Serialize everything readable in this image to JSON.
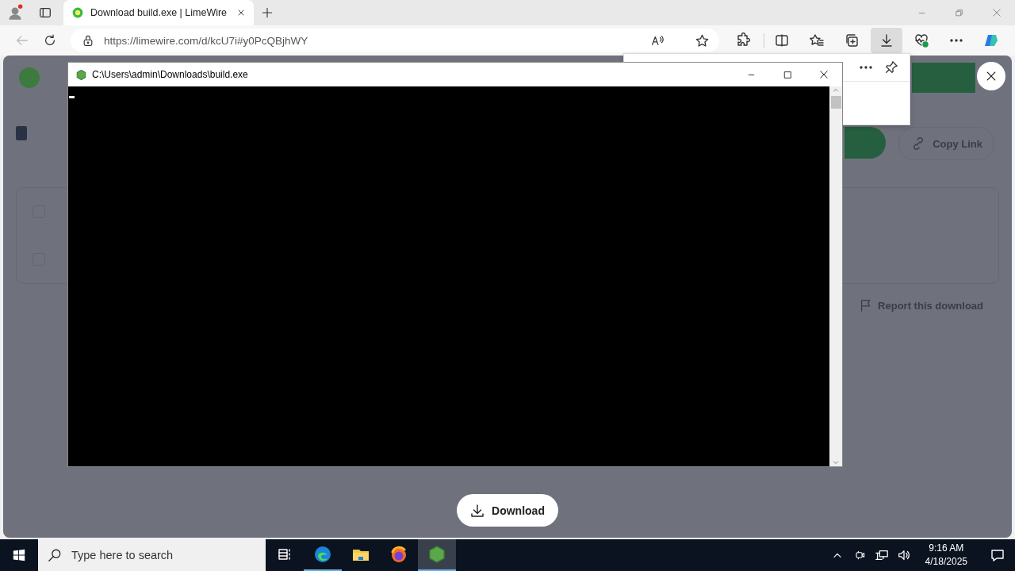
{
  "browser": {
    "tab": {
      "title": "Download build.exe | LimeWire",
      "selected": true
    },
    "url": "https://limewire.com/d/kcU7i#y0PcQBjhWY",
    "toolbar": [
      {
        "kind": "extensions",
        "selected": false
      },
      {
        "kind": "split",
        "selected": false
      },
      {
        "kind": "favorites",
        "selected": false
      },
      {
        "kind": "collections",
        "selected": false
      },
      {
        "kind": "downloads",
        "selected": true
      },
      {
        "kind": "health",
        "selected": false
      },
      {
        "kind": "more",
        "selected": false
      },
      {
        "kind": "copilot",
        "selected": false
      }
    ]
  },
  "page": {
    "checkboxes": [
      {
        "checked": false
      },
      {
        "checked": false
      }
    ],
    "copy_link": "Copy Link",
    "report": "Report this download",
    "download_button": "Download"
  },
  "console": {
    "title": "C:\\Users\\admin\\Downloads\\build.exe"
  },
  "taskbar": {
    "search_placeholder": "Type here to search",
    "apps": [
      {
        "kind": "edge",
        "running": true,
        "selected": false
      },
      {
        "kind": "explorer",
        "running": false,
        "selected": false
      },
      {
        "kind": "firefox",
        "running": false,
        "selected": false
      },
      {
        "kind": "console",
        "running": true,
        "selected": true
      }
    ],
    "time": "9:16 AM",
    "date": "4/18/2025"
  }
}
